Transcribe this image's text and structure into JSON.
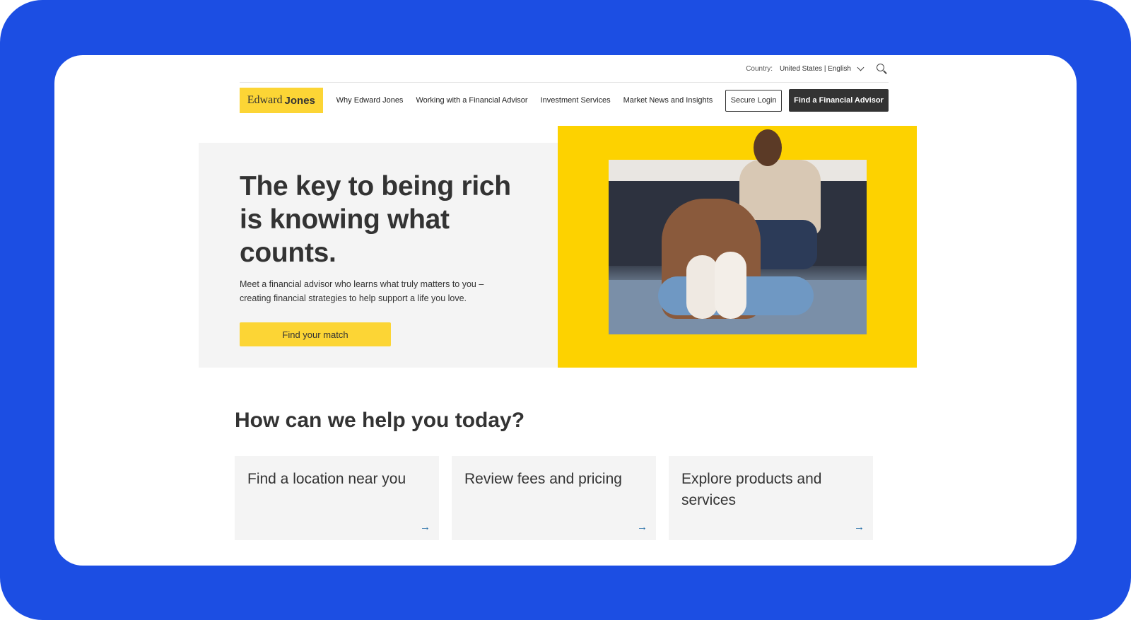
{
  "colors": {
    "frame": "#1c4ee3",
    "brand_yellow": "#fcd535",
    "hero_yellow": "#fdd200",
    "dark_button": "#333333",
    "arrow_blue": "#1f6aa5"
  },
  "topbar": {
    "country_label": "Country:",
    "country_value": "United States | English",
    "icons": [
      "chevron-down-icon",
      "search-icon"
    ]
  },
  "nav": {
    "logo_part1": "Edward",
    "logo_part2": "Jones",
    "links": [
      {
        "label": "Why Edward Jones"
      },
      {
        "label": "Working with a Financial Advisor"
      },
      {
        "label": "Investment Services"
      },
      {
        "label": "Market News and Insights"
      }
    ],
    "secure_login": "Secure Login",
    "find_advisor": "Find a Financial Advisor"
  },
  "hero": {
    "title": "The key to being rich is knowing what counts.",
    "subtitle": "Meet a financial advisor who learns what truly matters to you – creating financial strategies to help support a life you love.",
    "cta": "Find your match",
    "image_alt": "Family with three babies sitting by a sofa"
  },
  "help": {
    "title": "How can we help you today?",
    "tiles": [
      {
        "label": "Find a location near you",
        "icon": "arrow-right-icon",
        "arrow": "→"
      },
      {
        "label": "Review fees and pricing",
        "icon": "arrow-right-icon",
        "arrow": "→"
      },
      {
        "label": "Explore products and services",
        "icon": "arrow-right-icon",
        "arrow": "→"
      }
    ]
  }
}
